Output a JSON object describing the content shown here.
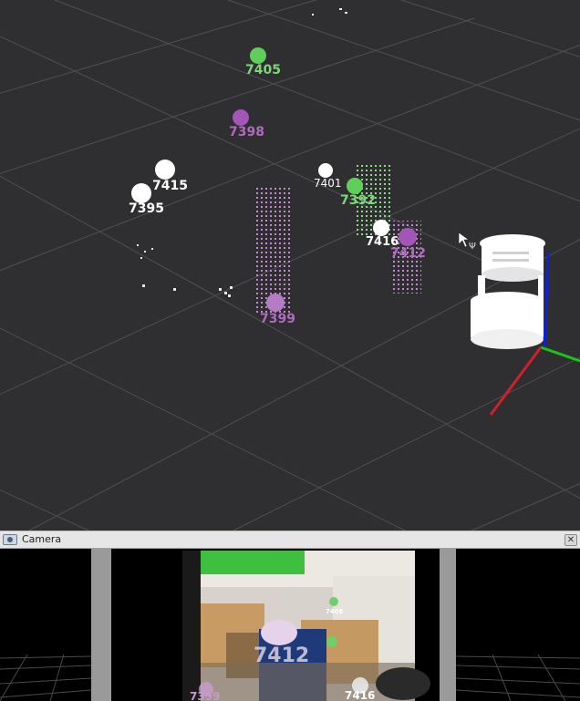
{
  "viewport": {
    "markers": [
      {
        "id": "7405",
        "color": "green"
      },
      {
        "id": "7398",
        "color": "purple"
      },
      {
        "id": "7415",
        "color": "white"
      },
      {
        "id": "7395",
        "color": "white"
      },
      {
        "id": "7401",
        "color": "white"
      },
      {
        "id": "7392",
        "color": "green"
      },
      {
        "id": "7416",
        "color": "white"
      },
      {
        "id": "7412",
        "color": "purple"
      },
      {
        "id": "7399",
        "color": "purple"
      }
    ],
    "axis_colors": {
      "x": "#d0202a",
      "y": "#18c41c",
      "z": "#1020d8"
    },
    "marker_colors": {
      "white": "#ffffff",
      "green": "#5fcf5a",
      "purple": "#a455b8"
    }
  },
  "camera_panel": {
    "title": "Camera",
    "close_glyph": "✕",
    "overlay_tags": [
      {
        "id": "7406"
      },
      {
        "id": "7412"
      },
      {
        "id": "7416"
      },
      {
        "id": "7399"
      }
    ]
  }
}
